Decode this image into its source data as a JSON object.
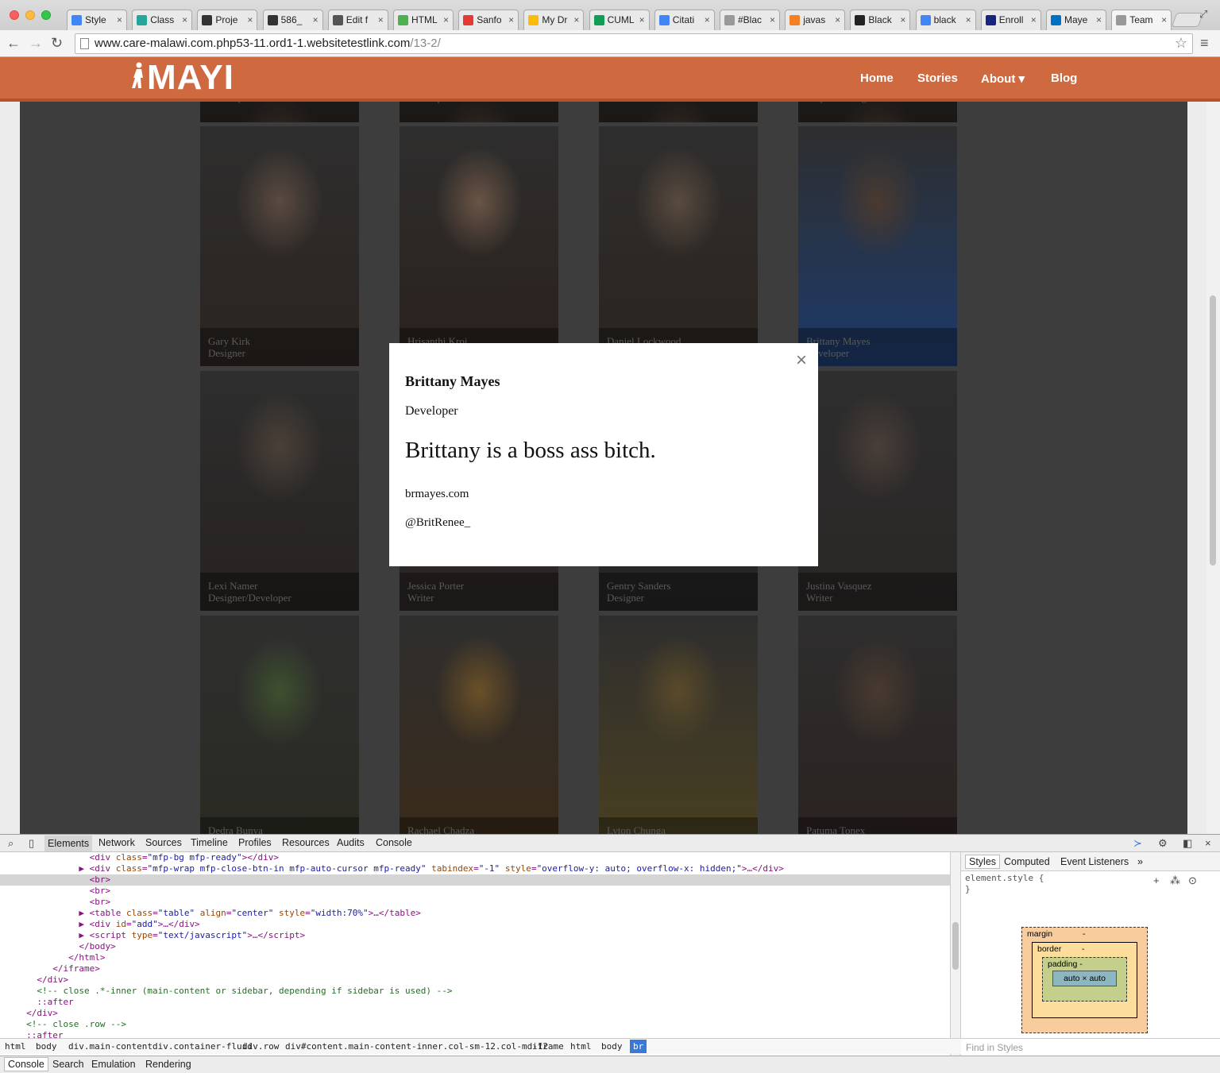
{
  "browser": {
    "tabs": [
      {
        "label": "Style",
        "color": "#4285f4"
      },
      {
        "label": "Class",
        "color": "#26a69a"
      },
      {
        "label": "Proje",
        "color": "#333333"
      },
      {
        "label": "586_",
        "color": "#333333"
      },
      {
        "label": "Edit f",
        "color": "#555555"
      },
      {
        "label": "HTML",
        "color": "#4caf50"
      },
      {
        "label": "Sanfo",
        "color": "#e53935"
      },
      {
        "label": "My Dr",
        "color": "#fbbc05"
      },
      {
        "label": "CUML",
        "color": "#0f9d58"
      },
      {
        "label": "Citati",
        "color": "#4285f4"
      },
      {
        "label": "#Blac",
        "color": "#999999"
      },
      {
        "label": "javas",
        "color": "#f48024"
      },
      {
        "label": "Black",
        "color": "#222222"
      },
      {
        "label": "black",
        "color": "#4285f4"
      },
      {
        "label": "Enroll",
        "color": "#1a237e"
      },
      {
        "label": "Maye",
        "color": "#0072c6"
      },
      {
        "label": "Team",
        "color": "#999999"
      }
    ],
    "url_host": "www.care-malawi.com.php53-11.ord1-1.websitetestlink.com",
    "url_path": "/13-2/"
  },
  "site": {
    "logo": "MAYI",
    "nav": [
      "Home",
      "Stories",
      "About",
      "Blog"
    ],
    "about_caret": "▾",
    "brand_color": "#cf6a40",
    "top_row": [
      {
        "role": "Developer"
      },
      {
        "role": "Developer"
      },
      {
        "role": "Writer"
      },
      {
        "role": "Project Manager/Writer"
      }
    ],
    "team": [
      {
        "name": "Gary Kirk",
        "role": "Designer"
      },
      {
        "name": "Hrisanthi Kroi",
        "role": "Writer"
      },
      {
        "name": "Daniel Lockwood",
        "role": "Writer"
      },
      {
        "name": "Brittany Mayes",
        "role": "Developer"
      },
      {
        "name": "Lexi Namer",
        "role": "Designer/Developer"
      },
      {
        "name": "Jessica Porter",
        "role": "Writer"
      },
      {
        "name": "Gentry Sanders",
        "role": "Designer"
      },
      {
        "name": "Justina Vasquez",
        "role": "Writer"
      },
      {
        "name": "Dedra Bunya",
        "role": ""
      },
      {
        "name": "Rachael Chadza",
        "role": ""
      },
      {
        "name": "Lyton Chunga",
        "role": ""
      },
      {
        "name": "Patuma Tonex",
        "role": ""
      }
    ]
  },
  "modal": {
    "close": "×",
    "name": "Brittany Mayes",
    "role": "Developer",
    "bio": "Brittany is a boss ass bitch.",
    "website": "brmayes.com",
    "twitter": "@BritRenee_"
  },
  "devtools": {
    "tabs": [
      "Elements",
      "Network",
      "Sources",
      "Timeline",
      "Profiles",
      "Resources",
      "Audits",
      "Console"
    ],
    "breadcrumbs": [
      "html",
      "body",
      "div.main-content",
      "div.container-fluid",
      "div.row",
      "div#content.main-content-inner.col-sm-12.col-md-12",
      "iframe",
      "html",
      "body",
      "br"
    ],
    "styles_tabs": [
      "Styles",
      "Computed",
      "Event Listeners",
      "»"
    ],
    "element_style": "element.style {",
    "element_style_close": "}",
    "box": {
      "margin": "margin",
      "border": "border",
      "padding": "padding -",
      "content": "auto × auto",
      "dash": "-"
    },
    "find_placeholder": "Find in Styles",
    "drawer_tabs": [
      "Console",
      "Search",
      "Emulation",
      "Rendering"
    ]
  }
}
